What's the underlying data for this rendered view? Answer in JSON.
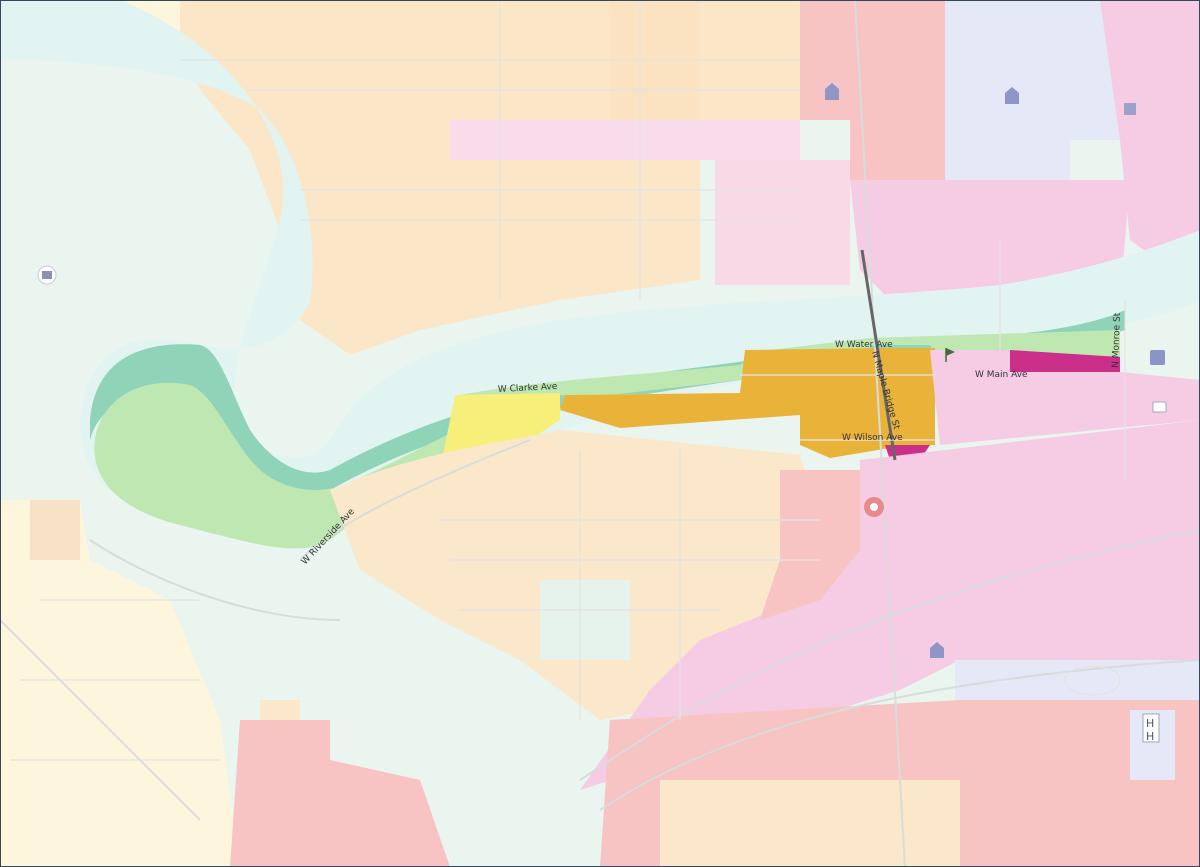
{
  "map": {
    "streets": [
      {
        "id": "water",
        "label": "W Water Ave"
      },
      {
        "id": "clarke",
        "label": "W Clarke Ave"
      },
      {
        "id": "main",
        "label": "W Main Ave"
      },
      {
        "id": "wilson",
        "label": "W Wilson Ave"
      },
      {
        "id": "riverside",
        "label": "W Riverside Ave"
      },
      {
        "id": "maple",
        "label": "N Maple Bridge St"
      },
      {
        "id": "monroe",
        "label": "N Monroe St"
      }
    ],
    "colors": {
      "river": "#e6f5f3",
      "park_green": "#bfe7b2",
      "riverbank": "#7fcfb2",
      "residential": "#fbe7c9",
      "residential_light": "#fdf6dc",
      "highlight_gold": "#e9b33a",
      "highlight_yellow": "#f6ef7a",
      "pink": "#f5cce3",
      "salmon": "#f7bfbf",
      "lavender": "#e4e8f7",
      "magenta": "#cc2f8a"
    },
    "icons": [
      "landmark-icon",
      "government-building-icon",
      "flag-icon",
      "fire-station-icon",
      "info-icon",
      "hospital-icon"
    ]
  }
}
